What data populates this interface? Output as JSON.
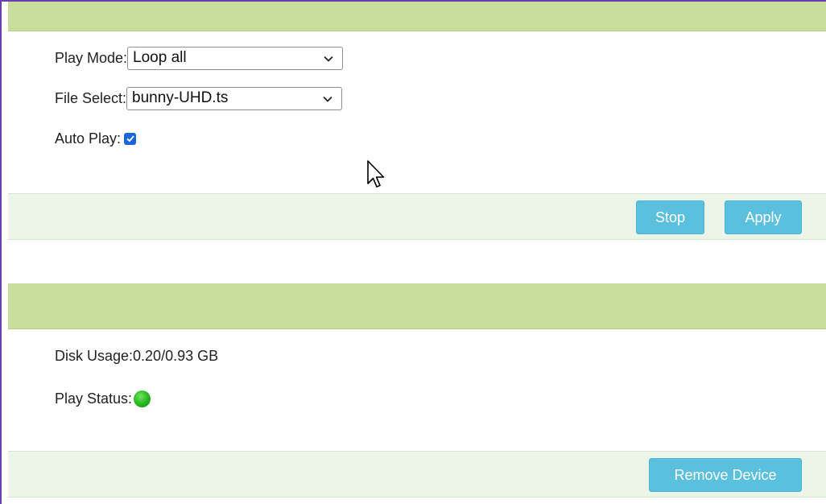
{
  "playback_panel": {
    "play_mode_label": "Play Mode:",
    "play_mode_value": "Loop all",
    "file_select_label": "File Select:",
    "file_select_value": "bunny-UHD.ts",
    "auto_play_label": "Auto Play:",
    "auto_play_checked": true,
    "stop_label": "Stop",
    "apply_label": "Apply"
  },
  "device_panel": {
    "disk_usage_text": "Disk Usage:0.20/0.93 GB",
    "play_status_label": "Play Status:",
    "play_status_state": "playing",
    "remove_device_label": "Remove Device"
  },
  "colors": {
    "header_green": "#c9dd9c",
    "footer_bg": "#edf4e8",
    "button_blue": "#5bc0de",
    "checkbox_blue": "#1a66d6",
    "status_green": "#24b321",
    "frame_purple": "#6a3fb0"
  },
  "icons": {
    "chevron": "chevron-down-icon",
    "check": "checkmark-icon",
    "cursor": "mouse-pointer-icon"
  }
}
